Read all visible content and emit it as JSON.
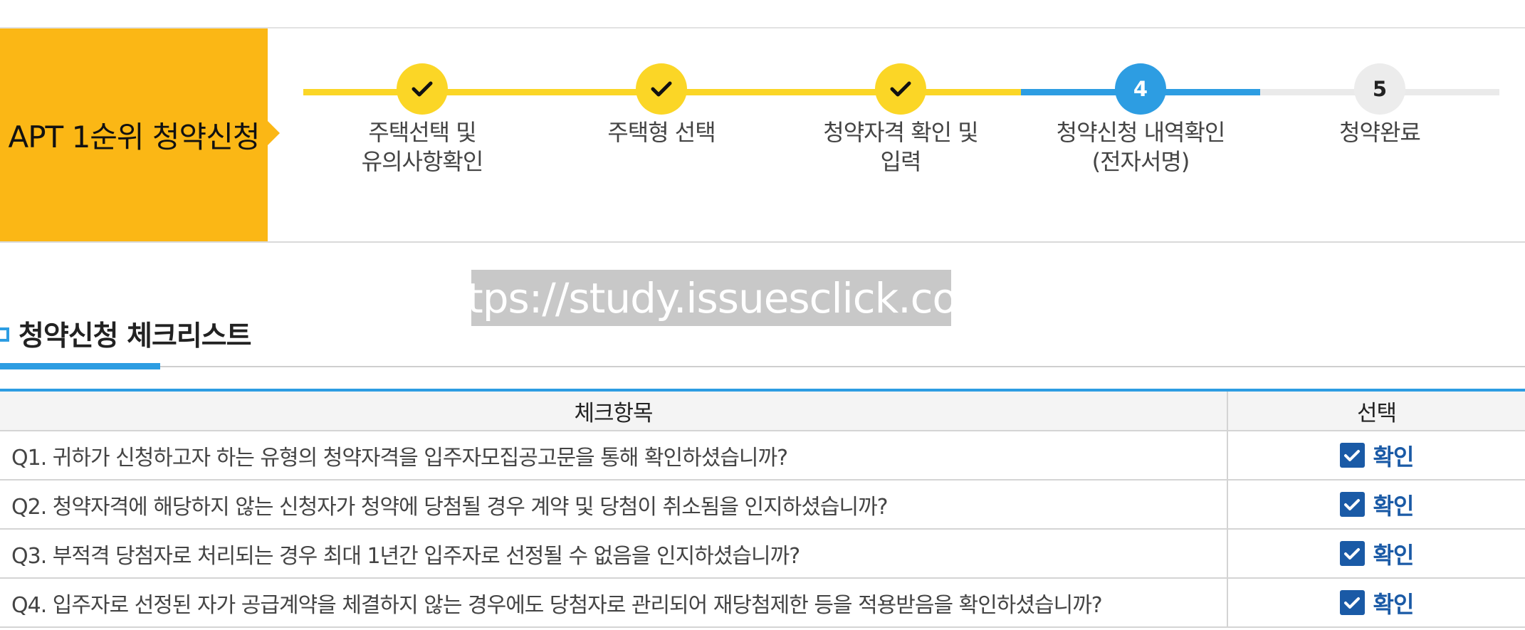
{
  "title": "APT 1순위 청약신청",
  "steps": [
    {
      "label": "주택선택 및\n유의사항확인",
      "status": "done",
      "icon": "check-icon"
    },
    {
      "label": "주택형 선택",
      "status": "done",
      "icon": "check-icon"
    },
    {
      "label": "청약자격 확인 및\n입력",
      "status": "done",
      "icon": "check-icon"
    },
    {
      "label": "청약신청 내역확인\n(전자서명)",
      "status": "active",
      "number": "4"
    },
    {
      "label": "청약완료",
      "status": "todo",
      "number": "5"
    }
  ],
  "watermark": "https://study.issuesclick.com",
  "checklist": {
    "heading": "청약신청 체크리스트",
    "columns": [
      "체크항목",
      "선택"
    ],
    "confirm_label": "확인",
    "rows": [
      "Q1. 귀하가 신청하고자 하는 유형의 청약자격을 입주자모집공고문을 통해 확인하셨습니까?",
      "Q2. 청약자격에 해당하지 않는 신청자가 청약에 당첨될 경우 계약 및 당첨이 취소됨을 인지하셨습니까?",
      "Q3. 부적격 당첨자로 처리되는 경우 최대 1년간 입주자로 선정될 수 없음을 인지하셨습니까?",
      "Q4. 입주자로 선정된 자가 공급계약을 체결하지 않는 경우에도 당첨자로 관리되어 재당첨제한 등을 적용받음을 확인하셨습니까?"
    ]
  },
  "colors": {
    "title_bg": "#fbb715",
    "done": "#fbd626",
    "active": "#2d9de2",
    "confirm": "#1a5aa6"
  }
}
